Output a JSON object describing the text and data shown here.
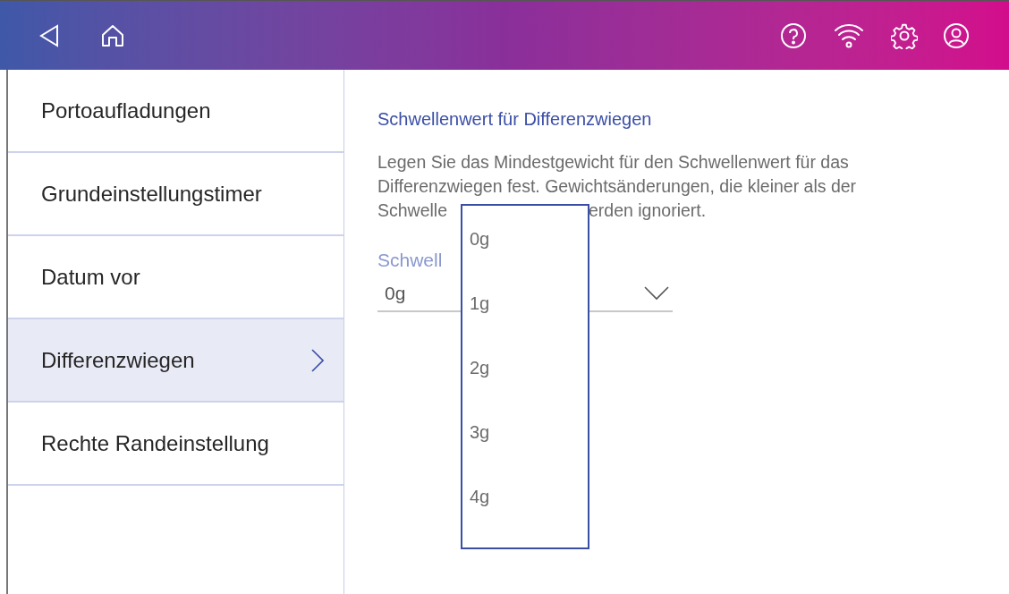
{
  "sidebar": {
    "items": [
      {
        "label": "Portoaufladungen",
        "selected": false
      },
      {
        "label": "Grundeinstellungstimer",
        "selected": false
      },
      {
        "label": "Datum vor",
        "selected": false
      },
      {
        "label": "Differenzwiegen",
        "selected": true
      },
      {
        "label": "Rechte Randeinstellung",
        "selected": false
      }
    ]
  },
  "content": {
    "title": "Schwellenwert für Differenzwiegen",
    "description_lines": [
      "Legen Sie das Mindestgewicht für den Schwellenwert für das",
      "Differenzwiegen fest. Gewichtsänderungen, die kleiner als der"
    ],
    "description_fragments": [
      "Schwelle",
      "erden ignoriert."
    ],
    "field": {
      "label": "Schwell",
      "value": "0g"
    }
  },
  "dropdown": {
    "options": [
      "0g",
      "1g",
      "2g",
      "3g",
      "4g"
    ]
  }
}
